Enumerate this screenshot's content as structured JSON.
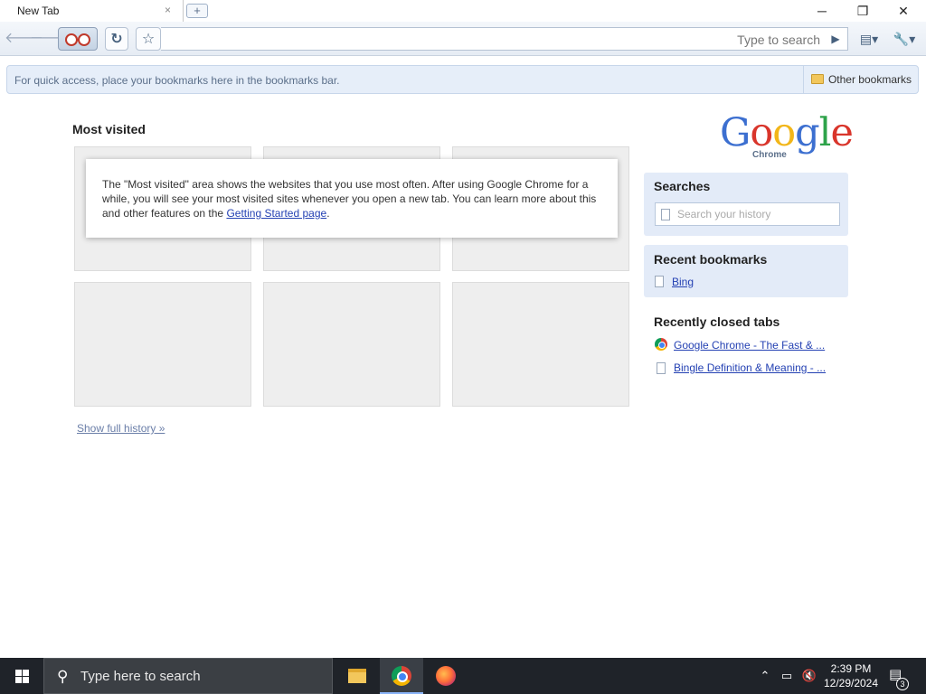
{
  "tab": {
    "title": "New Tab",
    "close": "×",
    "new_tab_icon": "+"
  },
  "window": {
    "minimize": "─",
    "restore": "❐",
    "close": "✕"
  },
  "toolbar": {
    "back_icon": "🡐",
    "forward_icon": "🡒",
    "reload_icon": "↻",
    "star_icon": "☆",
    "omnibox_placeholder": "Type to search",
    "go_icon": "▶",
    "page_menu_icon": "▤▾",
    "wrench_icon": "🔧▾"
  },
  "bookmarks_bar": {
    "message": "For quick access, place your bookmarks here in the bookmarks bar.",
    "other_bookmarks": "Other bookmarks"
  },
  "most_visited": {
    "title": "Most visited",
    "note_text": "The \"Most visited\" area shows the websites that you use most often. After using Google Chrome for a while, you will see your most visited sites whenever you open a new tab. You can learn more about this and other features on the ",
    "note_link": "Getting Started page",
    "note_end": "."
  },
  "show_full_history": "Show full history »",
  "logo": {
    "letters": [
      "G",
      "o",
      "o",
      "g",
      "l",
      "e"
    ],
    "colors": [
      "#3c6fd0",
      "#d9352b",
      "#f2b619",
      "#3c6fd0",
      "#2ea34a",
      "#d9352b"
    ],
    "subtitle": "Chrome"
  },
  "searches": {
    "title": "Searches",
    "placeholder": "Search your history"
  },
  "recent_bookmarks": {
    "title": "Recent bookmarks",
    "items": [
      "Bing"
    ]
  },
  "recently_closed": {
    "title": "Recently closed tabs",
    "items": [
      "Google Chrome - The Fast & ...",
      "Bingle Definition & Meaning - ..."
    ]
  },
  "taskbar": {
    "search_placeholder": "Type here to search",
    "time": "2:39 PM",
    "date": "12/29/2024",
    "notification_count": "3"
  }
}
